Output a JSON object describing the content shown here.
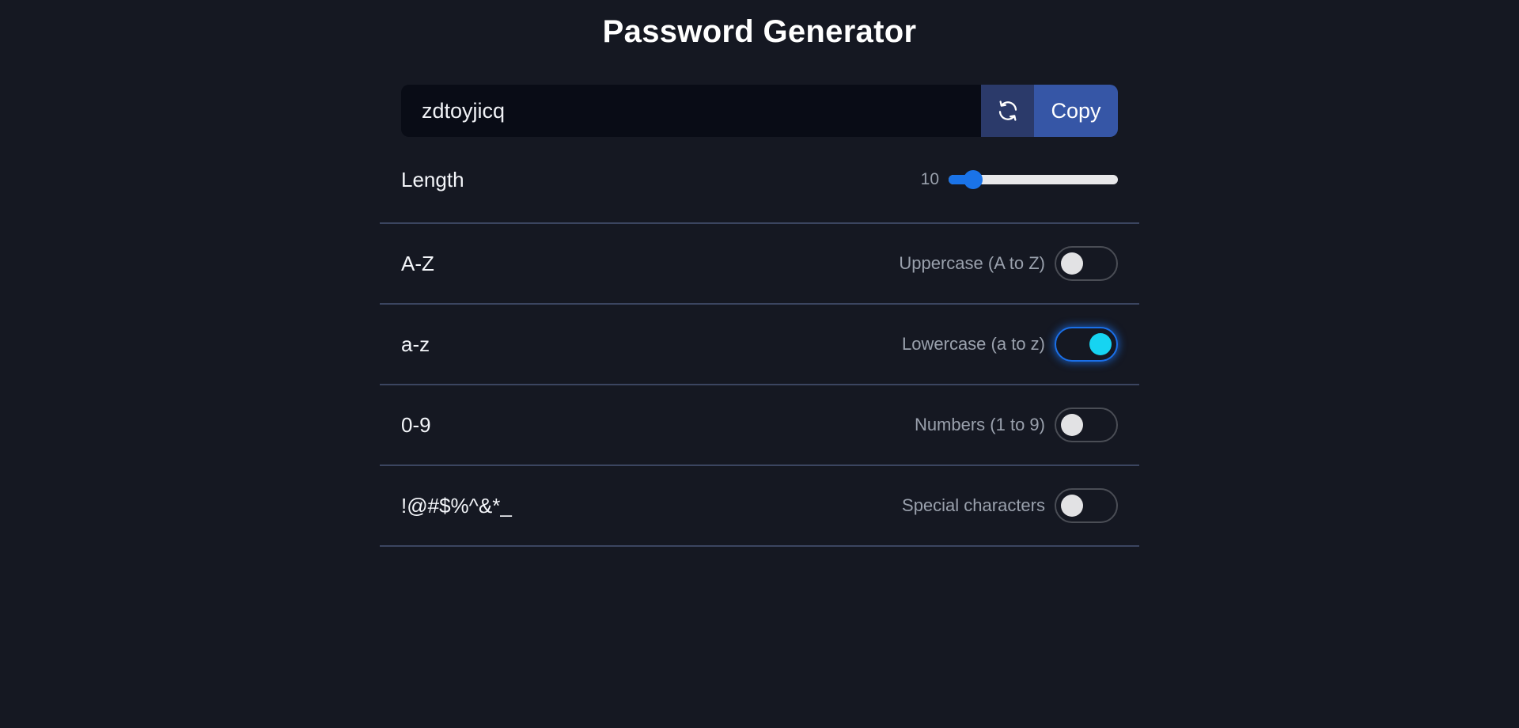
{
  "app": {
    "title": "Password Generator"
  },
  "password": {
    "value": "zdtoyjicq",
    "refresh_icon": "refresh-icon",
    "copy_label": "Copy"
  },
  "length": {
    "label": "Length",
    "value": "10",
    "slider_fraction": 0.1
  },
  "options": [
    {
      "label": "A-Z",
      "description": "Uppercase (A to Z)",
      "checked": false
    },
    {
      "label": "a-z",
      "description": "Lowercase (a to z)",
      "checked": true
    },
    {
      "label": "0-9",
      "description": "Numbers (1 to 9)",
      "checked": false
    },
    {
      "label": "!@#$%^&*_",
      "description": "Special characters",
      "checked": false
    }
  ],
  "colors": {
    "background": "#151822",
    "accent": "#1a73e8",
    "toggle_on_knob": "#16d4f2",
    "copy_button": "#3656a6",
    "refresh_button": "#2b3a6a"
  }
}
